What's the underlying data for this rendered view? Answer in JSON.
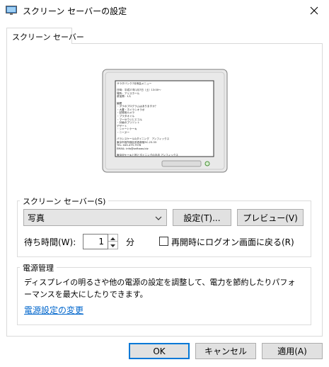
{
  "window": {
    "title": "スクリーン セーバーの設定"
  },
  "tabs": [
    {
      "label": "スクリーン セーバー"
    }
  ],
  "preview": {
    "lines": [
      "サラダバンク7月例会メニュー",
      "",
      "日時：平成27年1月7日（土）13:00〜",
      "場所：アリスホール",
      "参加費：1人",
      "",
      "議題",
      "・ダラのプログラムはありますか？",
      "・大豊・ホイラシオラポ",
      "・記録用カメラ",
      "・プラタオイル",
      "・マーセウジとエコル",
      "・計画のプリソント",
      "デザート",
      "・シャートケーキ",
      "・ニーヌー",
      "",
      "バランスケール&ダイニング　アンフィックス",
      "東京市役所宿区前西新宿5C-23-33",
      "TEL: 045-479-7978",
      "EMAIL: info@onfixoss.biz",
      "",
      "東京＠ケーキと松とダイニングのお店 アンフィックス",
      "http://www.onfixoss.biz/"
    ]
  },
  "screensaver": {
    "group_label": "スクリーン セーバー(S)",
    "selected": "写真",
    "settings_label": "設定(T)...",
    "preview_label": "プレビュー(V)",
    "wait_label": "待ち時間(W):",
    "wait_value": "1",
    "wait_unit": "分",
    "resume_label": "再開時にログオン画面に戻る(R)",
    "resume_checked": false
  },
  "power": {
    "group_label": "電源管理",
    "description": "ディスプレイの明るさや他の電源の設定を調整して、電力を節約したりパフォーマンスを最大にしたりできます。",
    "link_label": "電源設定の変更"
  },
  "footer": {
    "ok_label": "OK",
    "cancel_label": "キャンセル",
    "apply_label": "適用(A)"
  },
  "colors": {
    "accent": "#0078d7",
    "link": "#0066cc"
  },
  "icons": {
    "app": "display-icon",
    "close": "close-icon",
    "dropdown": "chevron-down-icon",
    "spin_up": "arrow-up-icon",
    "spin_down": "arrow-down-icon"
  }
}
